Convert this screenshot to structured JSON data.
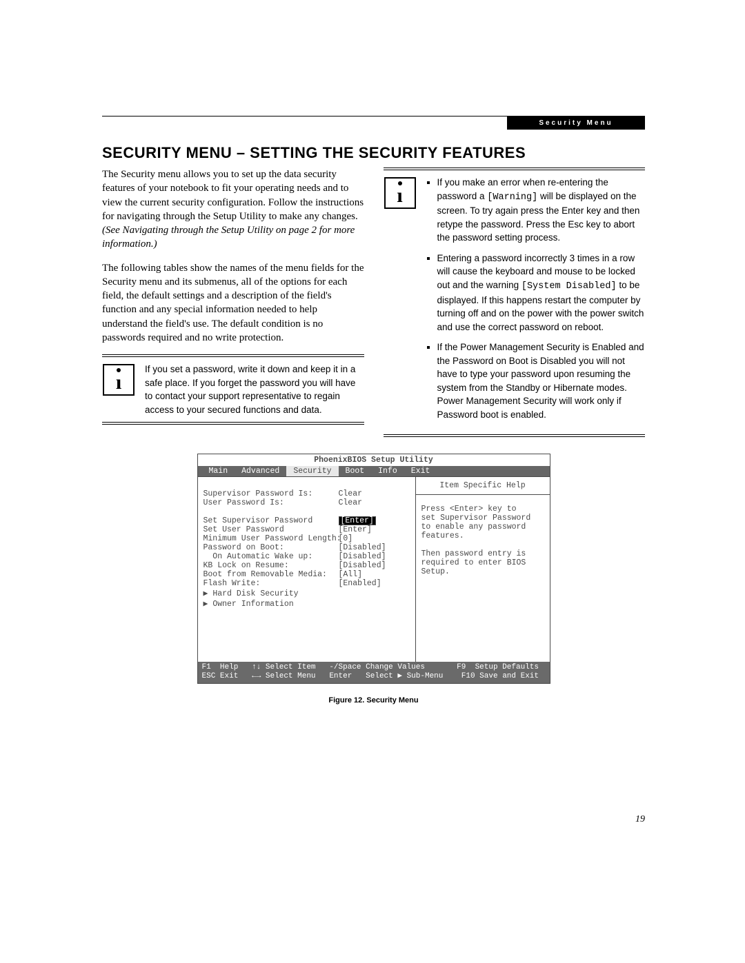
{
  "header_tab": "Security Menu",
  "title": "SECURITY MENU – SETTING THE SECURITY FEATURES",
  "col1": {
    "p1a": "The Security menu allows you to set up the data security features of your notebook to fit your operating needs and to view the current security configuration. Follow the instructions for navigating through the Setup Utility to make any changes. ",
    "p1b": "(See Navigating through the Setup Utility on page 2 for more information.)",
    "p2": "The following tables show the names of the menu fields for the Security menu and its submenus, all of the options for each field, the default settings and a description of the field's function and any special information needed to help understand the field's use. The default condition is no passwords required and no write protection.",
    "note": "If you set a password, write it down and keep it in a safe place. If you forget the password you will have to contact your support representative to regain access to your secured functions and data."
  },
  "col2": {
    "li1a": "If you make an error when re-entering the password a ",
    "li1_code": "[Warning]",
    "li1b": " will be displayed on the screen. To try again press the Enter key and then retype the password. Press the Esc key to abort the password setting process.",
    "li2a": "Entering a password incorrectly 3 times in a row will cause the keyboard and mouse to be locked out and the warning ",
    "li2_code": "[System Disabled]",
    "li2b": " to be displayed. If this happens restart the computer by turning off and on the power with the power switch and use the correct password on reboot.",
    "li3": "If the Power Management Security is Enabled and the Password on Boot is Disabled you will not have to type your password upon resuming the system from the Standby or Hibernate modes. Power Management Security will work only if Password boot is enabled."
  },
  "bios": {
    "title": "PhoenixBIOS Setup Utility",
    "tabs": [
      "Main",
      "Advanced",
      "Security",
      "Boot",
      "Info",
      "Exit"
    ],
    "active_tab": "Security",
    "rows": [
      {
        "lab": "Supervisor Password Is:",
        "val": "Clear"
      },
      {
        "lab": "User Password Is:",
        "val": "Clear"
      },
      {
        "blank": true
      },
      {
        "lab": "Set Supervisor Password",
        "val": "[Enter]",
        "selected": true
      },
      {
        "lab": "Set User Password",
        "val": "[Enter]"
      },
      {
        "lab": "Minimum User Password Length:",
        "val": "[0]"
      },
      {
        "lab": "Password on Boot:",
        "val": "[Disabled]"
      },
      {
        "lab": "  On Automatic Wake up:",
        "val": "[Disabled]"
      },
      {
        "lab": "KB Lock on Resume:",
        "val": "[Disabled]"
      },
      {
        "lab": "Boot from Removable Media:",
        "val": "[All]"
      },
      {
        "lab": "Flash Write:",
        "val": "[Enabled]"
      },
      {
        "lab": "▶ Hard Disk Security",
        "val": ""
      },
      {
        "lab": "▶ Owner Information",
        "val": ""
      }
    ],
    "help_title": "Item Specific Help",
    "help_text": "Press <Enter> key to\nset Supervisor Password\nto enable any password\nfeatures.\n\nThen password entry is\nrequired to enter BIOS\nSetup.",
    "footer1": "F1  Help   ↑↓ Select Item   -/Space Change Values       F9  Setup Defaults",
    "footer2": "ESC Exit   ←→ Select Menu   Enter   Select ▶ Sub-Menu    F10 Save and Exit"
  },
  "caption": "Figure 12.  Security Menu",
  "page_number": "19"
}
